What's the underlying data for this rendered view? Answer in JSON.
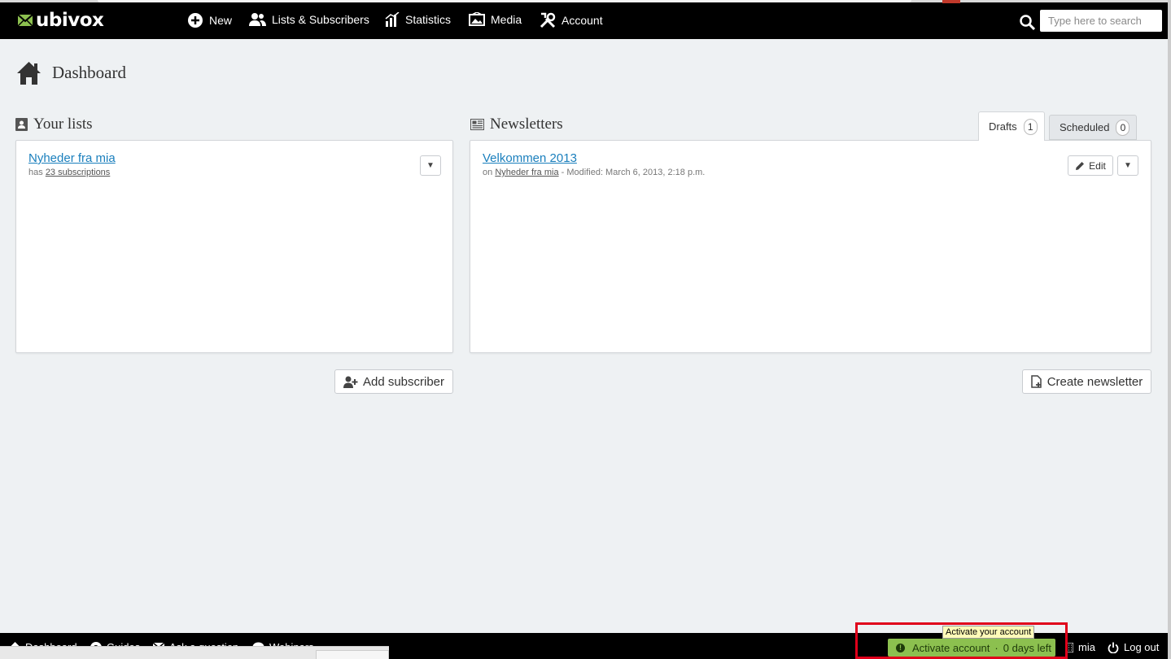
{
  "brand": {
    "name": "ubivox"
  },
  "nav": {
    "items": [
      {
        "label": "New",
        "icon": "plus-circle-icon"
      },
      {
        "label": "Lists & Subscribers",
        "icon": "users-icon"
      },
      {
        "label": "Statistics",
        "icon": "bar-chart-icon"
      },
      {
        "label": "Media",
        "icon": "image-icon"
      },
      {
        "label": "Account",
        "icon": "tools-icon"
      }
    ],
    "search_placeholder": "Type here to search"
  },
  "page": {
    "title": "Dashboard"
  },
  "lists": {
    "title": "Your lists",
    "items": [
      {
        "name": "Nyheder fra mia",
        "has_text": "has",
        "subscriptions": "23 subscriptions"
      }
    ],
    "add_button": "Add subscriber"
  },
  "newsletters": {
    "title": "Newsletters",
    "tabs": [
      {
        "label": "Drafts",
        "count": "1",
        "active": true
      },
      {
        "label": "Scheduled",
        "count": "0",
        "active": false
      }
    ],
    "items": [
      {
        "name": "Velkommen 2013",
        "on_text": "on",
        "list": "Nyheder fra mia",
        "modified": "- Modified: March 6, 2013, 2:18 p.m."
      }
    ],
    "edit_button": "Edit",
    "create_button": "Create newsletter"
  },
  "footer": {
    "items": [
      {
        "label": "Dashboard",
        "icon": "home-icon"
      },
      {
        "label": "Guides",
        "icon": "question-icon"
      },
      {
        "label": "Ask a question",
        "icon": "mail-icon"
      },
      {
        "label": "Webinars",
        "icon": "chat-icon"
      }
    ],
    "activate": {
      "label": "Activate account",
      "separator": "·",
      "days_left": "0 days left"
    },
    "tooltip": "Activate your account",
    "user": "mia",
    "logout": "Log out"
  },
  "colors": {
    "nav_bg": "#000000",
    "link": "#1a7fbd",
    "activate_bg": "#8cc04f",
    "highlight": "#e0001a"
  }
}
